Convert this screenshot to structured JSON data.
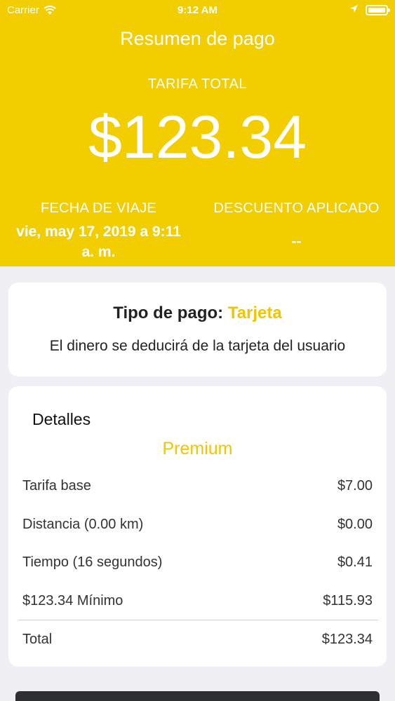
{
  "status_bar": {
    "carrier": "Carrier",
    "time": "9:12 AM"
  },
  "header": {
    "title": "Resumen de pago",
    "fare_label": "TARIFA TOTAL",
    "fare_amount": "$123.34",
    "trip_date_label": "FECHA DE VIAJE",
    "trip_date_value": "vie, may 17, 2019 a 9:11 a. m.",
    "discount_label": "DESCUENTO APLICADO",
    "discount_value": "--"
  },
  "payment": {
    "type_label": "Tipo de pago:",
    "type_value": "Tarjeta",
    "description": "El dinero se deducirá de la tarjeta del usuario"
  },
  "details": {
    "title": "Detalles",
    "plan": "Premium",
    "rows": [
      {
        "label": "Tarifa base",
        "value": "$7.00"
      },
      {
        "label": "Distancia (0.00 km)",
        "value": "$0.00"
      },
      {
        "label": "Tiempo (16 segundos)",
        "value": "$0.41"
      },
      {
        "label": "$123.34 Mínimo",
        "value": "$115.93"
      }
    ],
    "total_label": "Total",
    "total_value": "$123.34"
  },
  "colors": {
    "brand_yellow": "#f2cd00",
    "accent_yellow": "#f2c500",
    "background": "#efeff4"
  }
}
